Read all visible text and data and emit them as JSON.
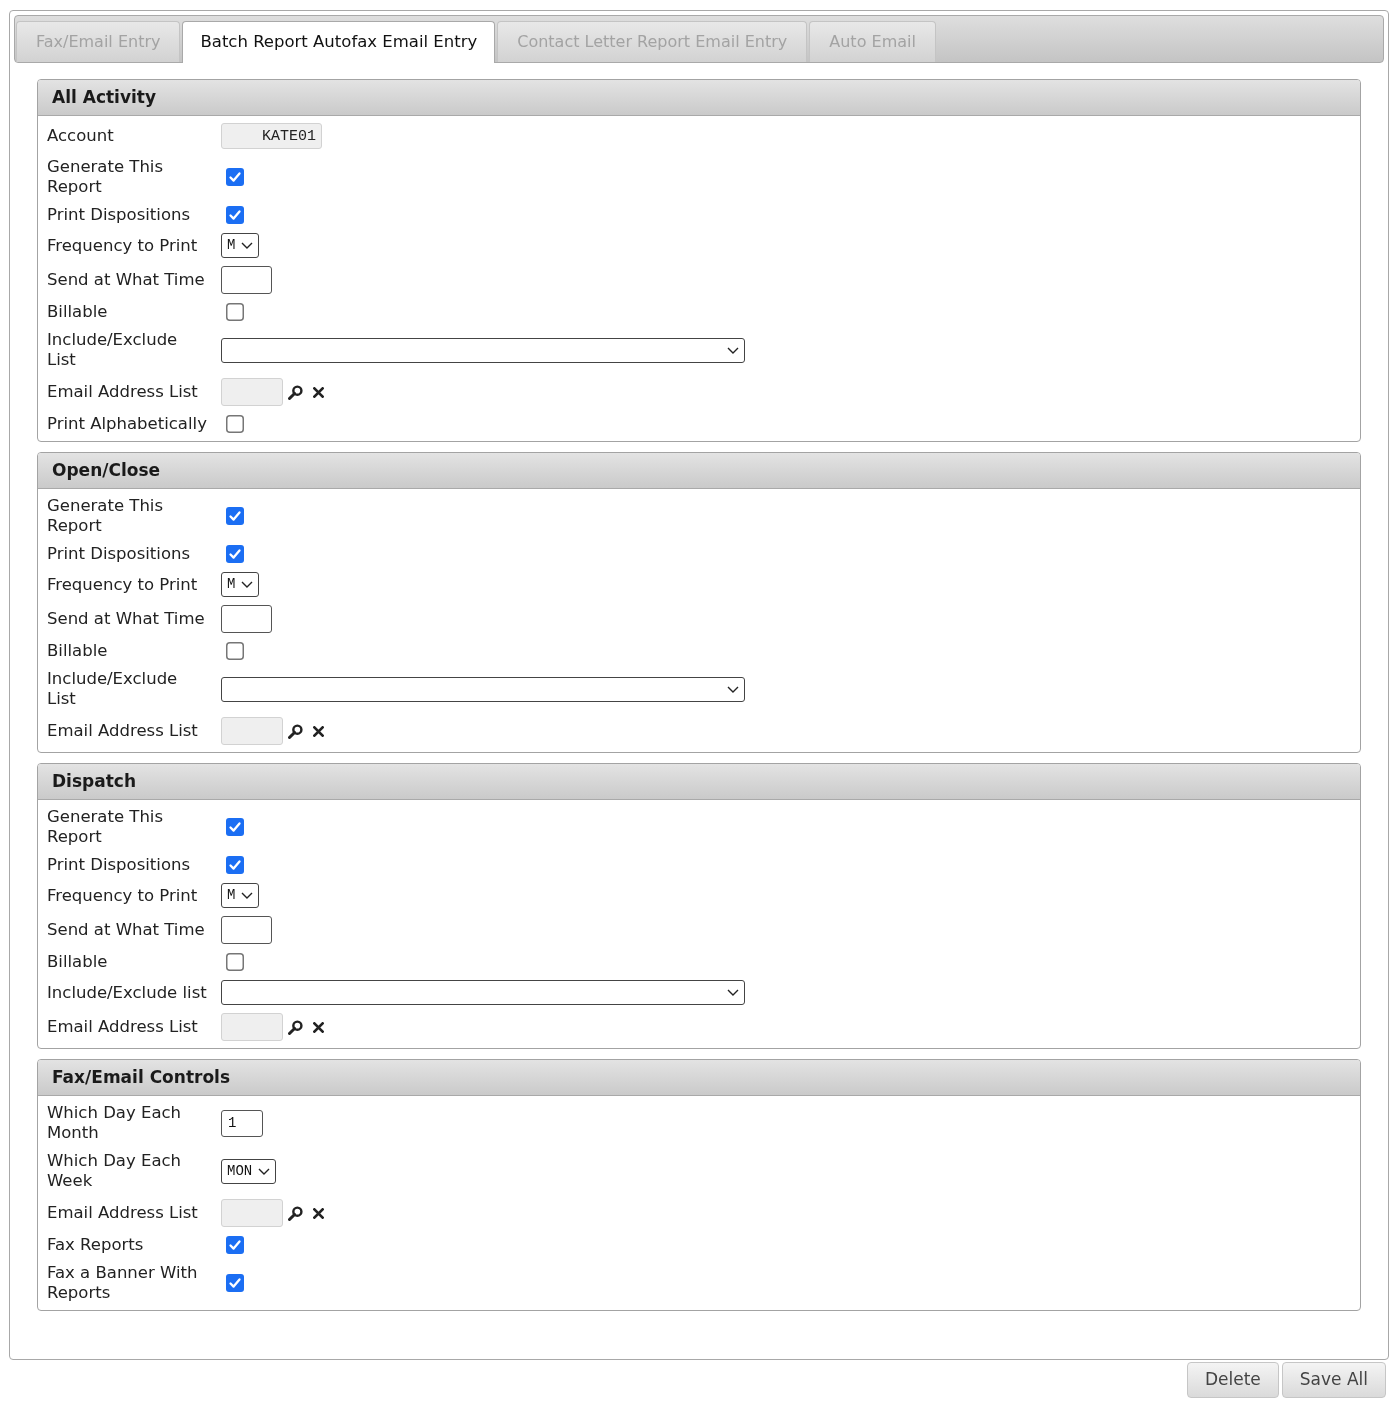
{
  "tabs": [
    {
      "label": "Fax/Email Entry",
      "selected": false
    },
    {
      "label": "Batch Report Autofax Email Entry",
      "selected": true
    },
    {
      "label": "Contact Letter Report Email Entry",
      "selected": false
    },
    {
      "label": "Auto Email",
      "selected": false
    }
  ],
  "sections": [
    {
      "title": "All Activity",
      "fields": [
        {
          "kind": "readonly",
          "label": "Account",
          "value": "KATE01"
        },
        {
          "kind": "checkbox",
          "label": "Generate This Report",
          "checked": true
        },
        {
          "kind": "checkbox",
          "label": "Print Dispositions",
          "checked": true
        },
        {
          "kind": "select",
          "label": "Frequency to Print",
          "value": "M"
        },
        {
          "kind": "time",
          "label": "Send at What Time"
        },
        {
          "kind": "checkbox",
          "label": "Billable",
          "checked": false
        },
        {
          "kind": "list",
          "label": "Include/Exclude List"
        },
        {
          "kind": "lookup",
          "label": "Email Address List"
        },
        {
          "kind": "checkbox",
          "label": "Print Alphabetically",
          "checked": false
        }
      ]
    },
    {
      "title": "Open/Close",
      "fields": [
        {
          "kind": "checkbox",
          "label": "Generate This Report",
          "checked": true
        },
        {
          "kind": "checkbox",
          "label": "Print Dispositions",
          "checked": true
        },
        {
          "kind": "select",
          "label": "Frequency to Print",
          "value": "M"
        },
        {
          "kind": "time",
          "label": "Send at What Time"
        },
        {
          "kind": "checkbox",
          "label": "Billable",
          "checked": false
        },
        {
          "kind": "list",
          "label": "Include/Exclude List"
        },
        {
          "kind": "lookup",
          "label": "Email Address List"
        }
      ]
    },
    {
      "title": "Dispatch",
      "fields": [
        {
          "kind": "checkbox",
          "label": "Generate This Report",
          "checked": true
        },
        {
          "kind": "checkbox",
          "label": "Print Dispositions",
          "checked": true
        },
        {
          "kind": "select",
          "label": "Frequency to Print",
          "value": "M"
        },
        {
          "kind": "time",
          "label": "Send at What Time"
        },
        {
          "kind": "checkbox",
          "label": "Billable",
          "checked": false
        },
        {
          "kind": "list",
          "label": "Include/Exclude list"
        },
        {
          "kind": "lookup",
          "label": "Email Address List"
        }
      ]
    },
    {
      "title": "Fax/Email Controls",
      "fields": [
        {
          "kind": "number",
          "label": "Which Day Each Month",
          "value": "1"
        },
        {
          "kind": "select",
          "label": "Which Day Each Week",
          "value": "MON"
        },
        {
          "kind": "lookup",
          "label": "Email Address List"
        },
        {
          "kind": "checkbox",
          "label": "Fax Reports",
          "checked": true
        },
        {
          "kind": "checkbox",
          "label": "Fax a Banner With Reports",
          "checked": true
        }
      ]
    }
  ],
  "buttons": [
    "Delete",
    "Save All"
  ]
}
